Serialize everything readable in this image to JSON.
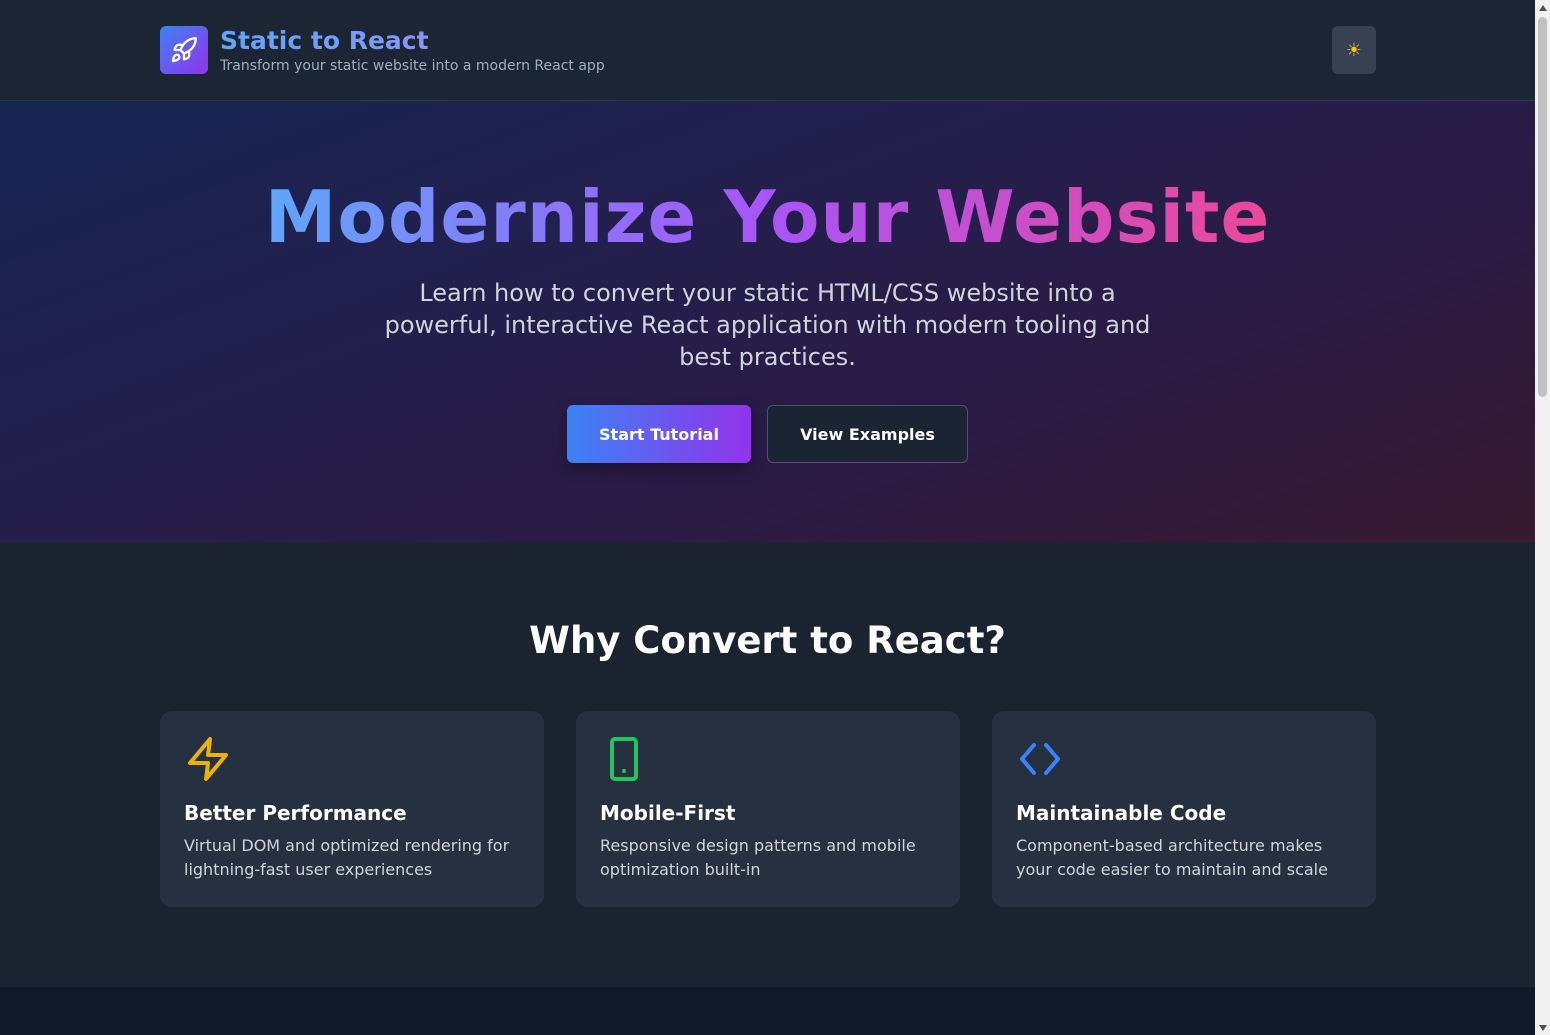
{
  "header": {
    "title": "Static to React",
    "subtitle": "Transform your static website into a modern React app",
    "logo_icon": "rocket-icon",
    "theme_toggle_icon": "☀"
  },
  "hero": {
    "title": "Modernize Your Website",
    "description": "Learn how to convert your static HTML/CSS website into a powerful, interactive React application with modern tooling and best practices.",
    "primary_button": "Start Tutorial",
    "secondary_button": "View Examples"
  },
  "features": {
    "title": "Why Convert to React?",
    "cards": [
      {
        "icon": "lightning-icon",
        "icon_color": "#eab308",
        "title": "Better Performance",
        "text": "Virtual DOM and optimized rendering for lightning-fast user experiences"
      },
      {
        "icon": "mobile-icon",
        "icon_color": "#22c55e",
        "title": "Mobile-First",
        "text": "Responsive design patterns and mobile optimization built-in"
      },
      {
        "icon": "code-icon",
        "icon_color": "#3b82f6",
        "title": "Maintainable Code",
        "text": "Component-based architecture makes your code easier to maintain and scale"
      }
    ]
  },
  "colors": {
    "accent_blue": "#3b82f6",
    "accent_purple": "#9333ea",
    "accent_pink": "#ec4899",
    "background": "#1b2331"
  }
}
